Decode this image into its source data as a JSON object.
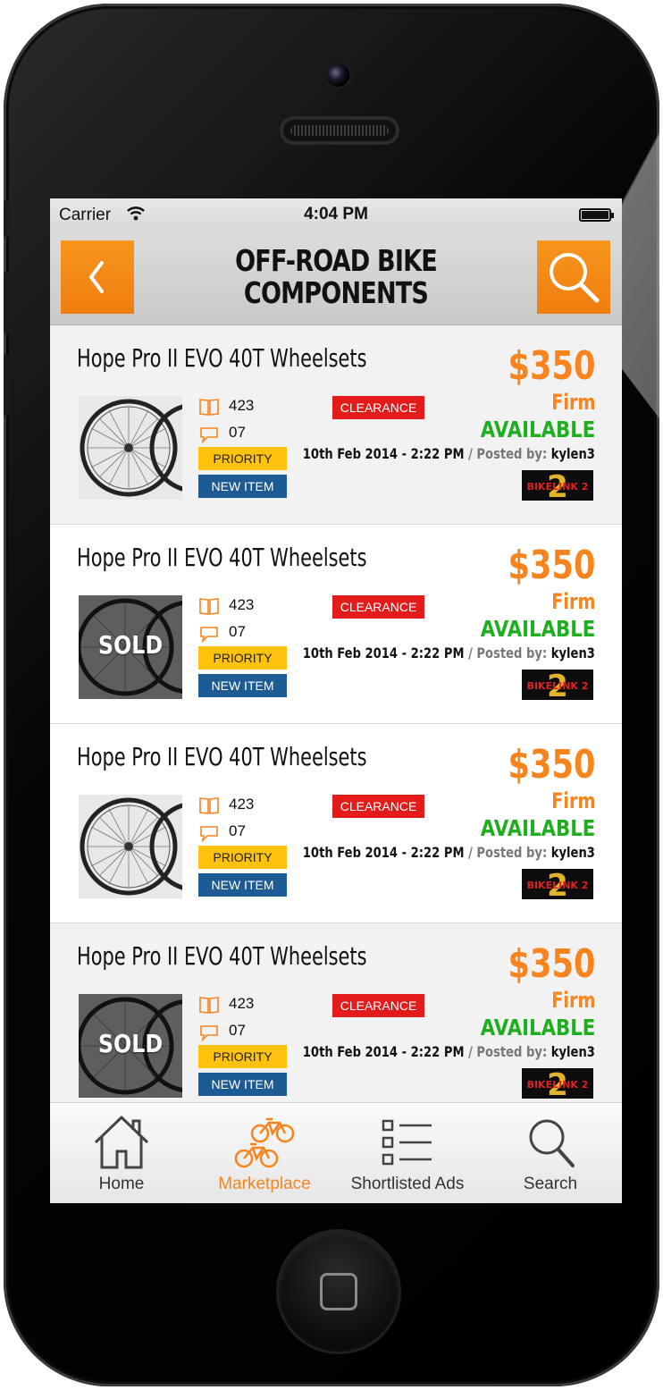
{
  "status_bar": {
    "carrier": "Carrier",
    "time": "4:04 PM"
  },
  "header": {
    "title_line1": "OFF-ROAD BIKE",
    "title_line2": "COMPONENTS"
  },
  "listings": [
    {
      "title": "Hope Pro II EVO 40T Wheelsets",
      "views": "423",
      "comments": "07",
      "priority_label": "PRIORITY",
      "new_label": "NEW ITEM",
      "clearance_label": "CLEARANCE",
      "price": "$350",
      "price_note": "Firm",
      "availability": "AVAILABLE",
      "date": "10th Feb 2014 - 2:22 PM",
      "posted_by_label": "/ Posted by:",
      "seller": "kylen3",
      "sold": false,
      "sold_label": ""
    },
    {
      "title": "Hope Pro II EVO 40T Wheelsets",
      "views": "423",
      "comments": "07",
      "priority_label": "PRIORITY",
      "new_label": "NEW ITEM",
      "clearance_label": "CLEARANCE",
      "price": "$350",
      "price_note": "Firm",
      "availability": "AVAILABLE",
      "date": "10th Feb 2014 - 2:22 PM",
      "posted_by_label": "/ Posted by:",
      "seller": "kylen3",
      "sold": true,
      "sold_label": "SOLD"
    },
    {
      "title": "Hope Pro II EVO 40T Wheelsets",
      "views": "423",
      "comments": "07",
      "priority_label": "PRIORITY",
      "new_label": "NEW ITEM",
      "clearance_label": "CLEARANCE",
      "price": "$350",
      "price_note": "Firm",
      "availability": "AVAILABLE",
      "date": "10th Feb 2014 - 2:22 PM",
      "posted_by_label": "/ Posted by:",
      "seller": "kylen3",
      "sold": false,
      "sold_label": ""
    },
    {
      "title": "Hope Pro II EVO 40T Wheelsets",
      "views": "423",
      "comments": "07",
      "priority_label": "PRIORITY",
      "new_label": "NEW ITEM",
      "clearance_label": "CLEARANCE",
      "price": "$350",
      "price_note": "Firm",
      "availability": "AVAILABLE",
      "date": "10th Feb 2014 - 2:22 PM",
      "posted_by_label": "/ Posted by:",
      "seller": "kylen3",
      "sold": true,
      "sold_label": "SOLD"
    }
  ],
  "tabbar": {
    "items": [
      {
        "label": "Home",
        "icon": "house-icon",
        "active": false
      },
      {
        "label": "Marketplace",
        "icon": "bicycles-icon",
        "active": true
      },
      {
        "label": "Shortlisted Ads",
        "icon": "checklist-icon",
        "active": false
      },
      {
        "label": "Search",
        "icon": "magnifier-icon",
        "active": false
      }
    ]
  },
  "colors": {
    "accent": "#f7841d",
    "available": "#1fae1f",
    "priority": "#ffc20e",
    "new_item": "#1d5b95",
    "clearance": "#e31b1b"
  },
  "seller_logo_text": "BIKELINK 2"
}
